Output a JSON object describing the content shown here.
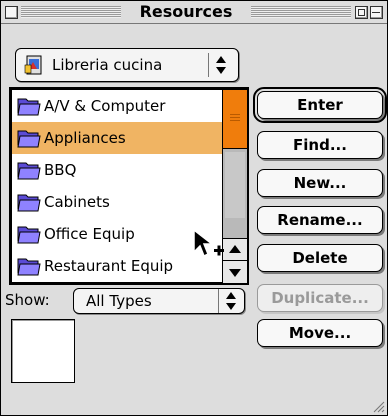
{
  "window": {
    "title": "Resources"
  },
  "library_popup": {
    "value": "Libreria cucina",
    "icon": "library-file-icon"
  },
  "resource_list": {
    "items": [
      {
        "label": "A/V & Computer",
        "icon": "folder-icon",
        "selected": false
      },
      {
        "label": "Appliances",
        "icon": "folder-icon",
        "selected": true
      },
      {
        "label": "BBQ",
        "icon": "folder-icon",
        "selected": false
      },
      {
        "label": "Cabinets",
        "icon": "folder-icon",
        "selected": false
      },
      {
        "label": "Office Equip",
        "icon": "folder-icon",
        "selected": false
      },
      {
        "label": "Restaurant Equip",
        "icon": "folder-icon",
        "selected": false
      }
    ],
    "selection_color": "#f0b463",
    "scroll_thumb_color": "#f07d0c"
  },
  "actions": {
    "enter": "Enter",
    "find": "Find...",
    "new": "New...",
    "rename": "Rename...",
    "delete": "Delete",
    "duplicate": "Duplicate...",
    "move": "Move..."
  },
  "filter": {
    "label": "Show:",
    "value": "All Types"
  }
}
